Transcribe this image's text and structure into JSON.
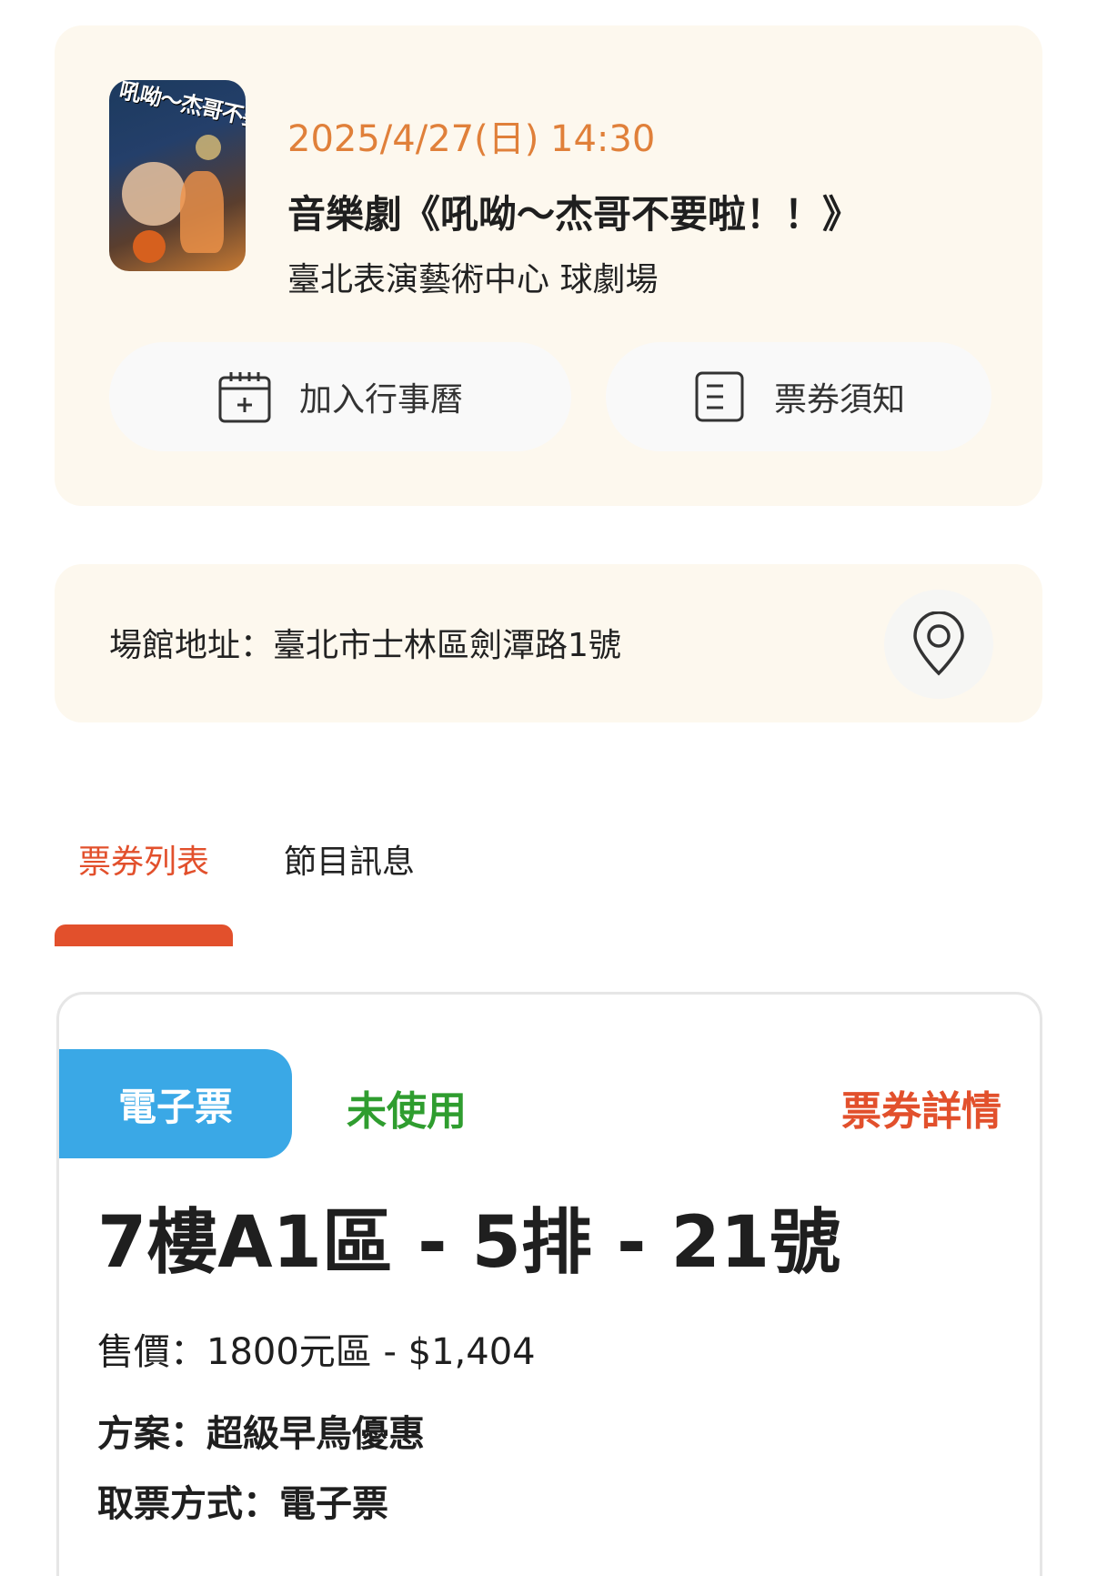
{
  "event": {
    "poster_title": "吼呦～杰哥不要啦!!",
    "date_time": "2025/4/27(日) 14:30",
    "title": "音樂劇《吼呦～杰哥不要啦！！》",
    "venue": "臺北表演藝術中心 球劇場",
    "calendar_button_label": "加入行事曆",
    "notice_button_label": "票券須知",
    "calendar_icon": "calendar-add-icon",
    "notice_icon": "document-list-icon"
  },
  "address": {
    "text": "場館地址：臺北市士林區劍潭路1號",
    "map_icon": "map-pin-icon"
  },
  "tabs": [
    {
      "label": "票券列表",
      "active": true
    },
    {
      "label": "節目訊息",
      "active": false
    }
  ],
  "ticket": {
    "type_badge": "電子票",
    "status": "未使用",
    "detail_link": "票券詳情",
    "seat": "7樓A1區 - 5排 - 21號",
    "price": "售價：1800元區 - $1,404",
    "plan": "方案：超級早鳥優惠",
    "pickup": "取票方式：電子票"
  },
  "colors": {
    "accent_orange": "#e0803a",
    "tab_active": "#e2502c",
    "badge_blue": "#3aa8e6",
    "status_green": "#2f9d2f",
    "card_bg": "#fdf8ee"
  }
}
